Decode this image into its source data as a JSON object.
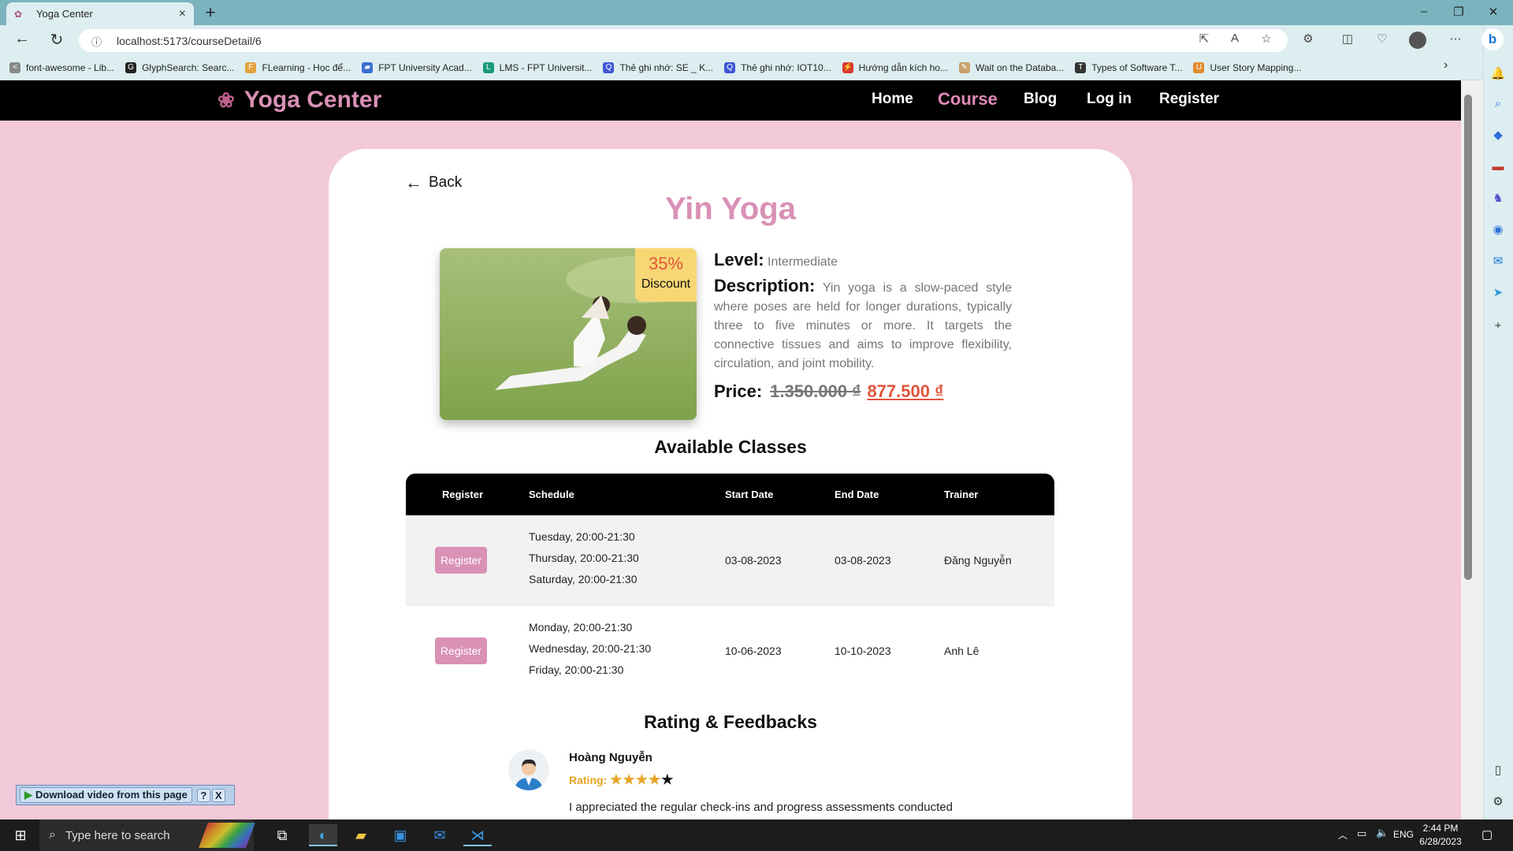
{
  "browser": {
    "tab_title": "Yoga Center",
    "url": "localhost:5173/courseDetail/6",
    "bookmarks": [
      "font-awesome - Lib...",
      "GlyphSearch: Searc...",
      "FLearning - Học để...",
      "FPT University Acad...",
      "LMS - FPT Universit...",
      "Thẻ ghi nhớ: SE _ K...",
      "Thẻ ghi nhớ: IOT10...",
      "Hướng dẫn kích ho...",
      "Wait on the Databa...",
      "Types of Software T...",
      "User Story Mapping..."
    ]
  },
  "site": {
    "brand": "Yoga Center",
    "nav": {
      "home": "Home",
      "course": "Course",
      "blog": "Blog",
      "login": "Log in",
      "register": "Register"
    }
  },
  "course": {
    "back_label": "Back",
    "title": "Yin Yoga",
    "discount_percent": "35%",
    "discount_label": "Discount",
    "level_label": "Level:",
    "level_value": "Intermediate",
    "description_label": "Description:",
    "description": "Yin yoga is a slow-paced style where poses are held for longer durations, typically three to five minutes or more. It targets the connective tissues and aims to improve flexibility, circulation, and joint mobility.",
    "price_label": "Price:",
    "old_price": "1.350.000 ₫",
    "new_price": "877.500 ₫"
  },
  "classes": {
    "heading": "Available Classes",
    "columns": {
      "register": "Register",
      "schedule": "Schedule",
      "start": "Start Date",
      "end": "End Date",
      "trainer": "Trainer"
    },
    "rows": [
      {
        "button": "Register",
        "schedule": [
          "Tuesday, 20:00-21:30",
          "Thursday, 20:00-21:30",
          "Saturday, 20:00-21:30"
        ],
        "start": "03-08-2023",
        "end": "03-08-2023",
        "trainer": "Đăng Nguyễn"
      },
      {
        "button": "Register",
        "schedule": [
          "Monday, 20:00-21:30",
          "Wednesday, 20:00-21:30",
          "Friday, 20:00-21:30"
        ],
        "start": "10-06-2023",
        "end": "10-10-2023",
        "trainer": "Anh Lê"
      }
    ]
  },
  "feedback": {
    "heading": "Rating & Feedbacks",
    "reviewer": "Hoàng Nguyễn",
    "rating_label": "Rating:",
    "rating_value": 4,
    "rating_max": 5,
    "text": "I appreciated the regular check-ins and progress assessments conducted"
  },
  "download_bar": {
    "label": "Download video from this page",
    "help": "?",
    "close": "X"
  },
  "taskbar": {
    "search_placeholder": "Type here to search",
    "lang": "ENG",
    "time": "2:44 PM",
    "date": "6/28/2023"
  },
  "colors": {
    "accent": "#d991b6",
    "discount_red": "#e2543c",
    "badge_yellow": "#f7d774",
    "page_bg": "#f2c9d8"
  }
}
